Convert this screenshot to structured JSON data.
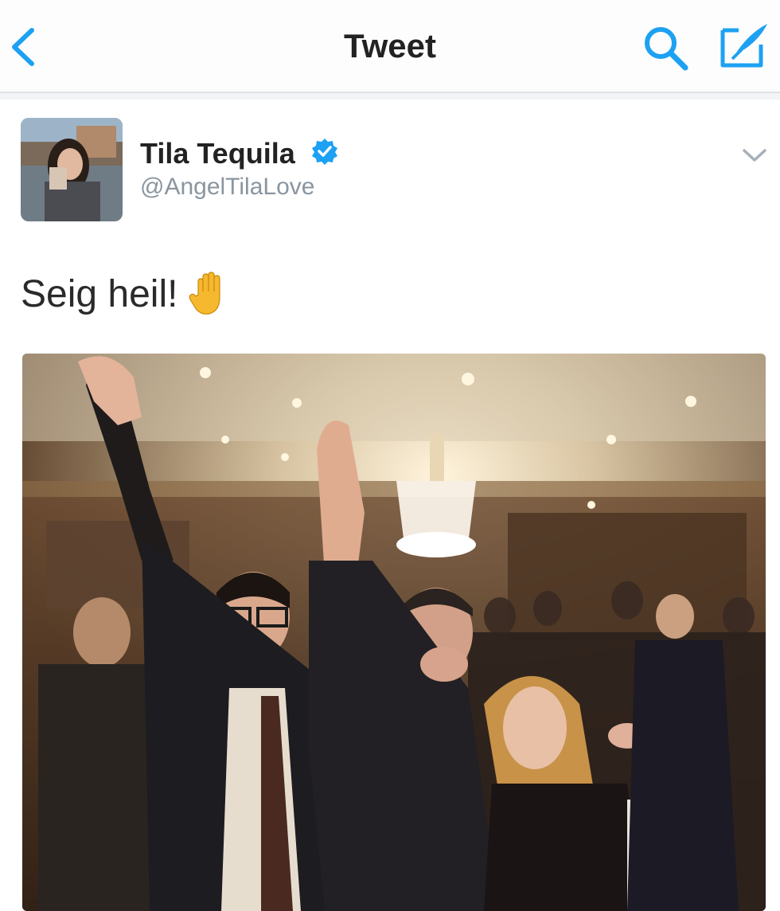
{
  "nav": {
    "title": "Tweet",
    "back_icon": "chevron-left-icon",
    "search_icon": "search-icon",
    "compose_icon": "compose-icon",
    "accent_color": "#1da1f2"
  },
  "tweet": {
    "author": {
      "name": "Tila Tequila",
      "handle": "@AngelTilaLove",
      "verified": true,
      "verified_icon": "verified-badge-icon"
    },
    "menu_icon": "chevron-down-icon",
    "text": "Seig heil!",
    "emoji": "raised-hand-emoji",
    "media": {
      "type": "photo",
      "scene": "crowded banquet hall with chandelier; group of people posing"
    }
  }
}
